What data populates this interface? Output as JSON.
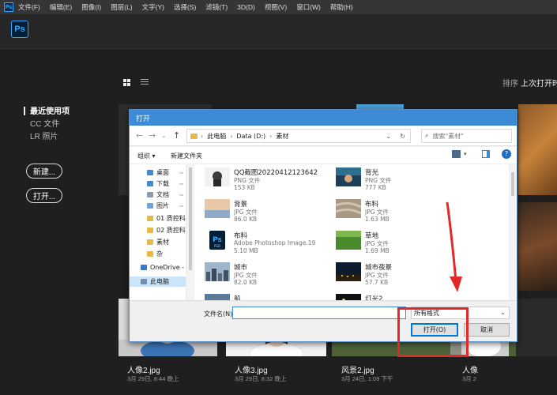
{
  "menubar": {
    "logo": "Ps",
    "items": [
      "文件(F)",
      "编辑(E)",
      "图像(I)",
      "图层(L)",
      "文字(Y)",
      "选择(S)",
      "滤镜(T)",
      "3D(D)",
      "视图(V)",
      "窗口(W)",
      "帮助(H)"
    ]
  },
  "header": {
    "logo": "Ps"
  },
  "sort": {
    "label": "排序",
    "value": "上次打开时"
  },
  "nav": {
    "items": [
      "最近使用项",
      "CC 文件",
      "LR 照片"
    ],
    "new_button": "新建...",
    "open_button": "打开..."
  },
  "thumbnails": [
    {
      "name": "人像2.jpg",
      "date": "3月 29日, 8:44 晚上"
    },
    {
      "name": "人像3.jpg",
      "date": "3月 29日, 8:32 晚上"
    },
    {
      "name": "风景2.jpg",
      "date": "3月 24日, 1:09 下午"
    },
    {
      "name": "人像",
      "date": "3月 2"
    }
  ],
  "dialog": {
    "title": "打开",
    "address": {
      "root": "此电脑",
      "drive": "Data (D:)",
      "folder": "素材"
    },
    "search_placeholder": "搜索\"素材\"",
    "toolbar": {
      "organize": "组织 ▾",
      "new_folder": "新建文件夹"
    },
    "tree": [
      {
        "label": "桌面",
        "pinned": true,
        "color": "#3d8bd6"
      },
      {
        "label": "下载",
        "pinned": true,
        "color": "#3d8bd6"
      },
      {
        "label": "文档",
        "pinned": true,
        "color": "#8a9bb0"
      },
      {
        "label": "图片",
        "pinned": true,
        "color": "#6aa7d8"
      },
      {
        "label": "01 质控科",
        "pinned": false,
        "color": "#e8b84a"
      },
      {
        "label": "02 质控科",
        "pinned": false,
        "color": "#e8b84a"
      },
      {
        "label": "素材",
        "pinned": false,
        "color": "#e8b84a"
      },
      {
        "label": "杂",
        "pinned": false,
        "color": "#e8b84a"
      },
      {
        "label": "OneDrive -",
        "pinned": false,
        "color": "#2f7bd1"
      },
      {
        "label": "此电脑",
        "pinned": false,
        "color": "#6f8fb0"
      }
    ],
    "files": [
      {
        "name": "QQ截图20220412123642",
        "type": "PNG 文件",
        "size": "153 KB",
        "thumb": "portrait-bw"
      },
      {
        "name": "背光",
        "type": "PNG 文件",
        "size": "777 KB",
        "thumb": "backlight"
      },
      {
        "name": "背景",
        "type": "JPG 文件",
        "size": "86.0 KB",
        "thumb": "sky"
      },
      {
        "name": "布料",
        "type": "JPG 文件",
        "size": "1.63 MB",
        "thumb": "fabric"
      },
      {
        "name": "布料",
        "type": "Adobe Photoshop Image.19",
        "size": "5.10 MB",
        "thumb": "psd"
      },
      {
        "name": "草地",
        "type": "JPG 文件",
        "size": "1.69 MB",
        "thumb": "grass"
      },
      {
        "name": "城市",
        "type": "JPG 文件",
        "size": "82.0 KB",
        "thumb": "city"
      },
      {
        "name": "城市夜景",
        "type": "JPG 文件",
        "size": "57.7 KB",
        "thumb": "night"
      },
      {
        "name": "船",
        "type": "",
        "size": "",
        "thumb": "boat"
      },
      {
        "name": "灯光2",
        "type": "",
        "size": "",
        "thumb": "lights"
      }
    ],
    "filename_label": "文件名(N):",
    "filename_value": "",
    "filetype_value": "所有格式",
    "open_button": "打开(O)",
    "cancel_button": "取消"
  },
  "colors": {
    "app_bg": "#1f1f1f",
    "menubar_bg": "#353535",
    "ps_blue": "#31a8ff",
    "dialog_title_bg": "#3d8bd6",
    "annotation_red": "#e02a2a"
  }
}
